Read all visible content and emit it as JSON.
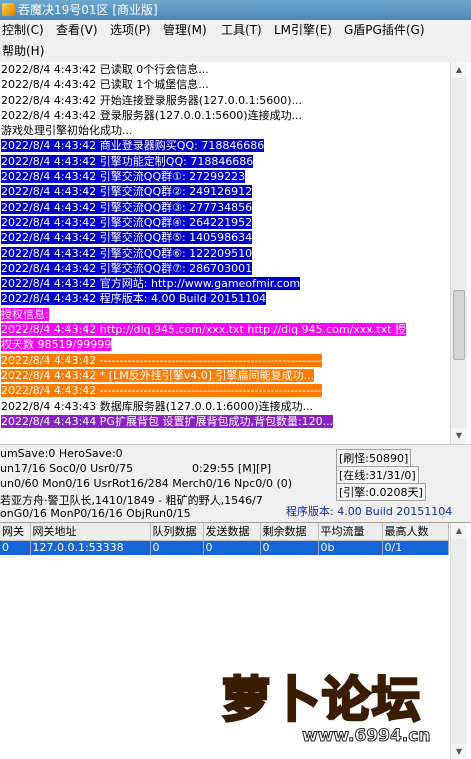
{
  "window": {
    "title": "吞魔决19号01区 [商业版]"
  },
  "menu": [
    "控制(C)",
    "查看(V)",
    "选项(P)",
    "管理(M)",
    "工具(T)",
    "LM引擎(E)",
    "G盾PG插件(G)",
    "帮助(H)"
  ],
  "log_lines": [
    {
      "text": "2022/8/4 4:43:42 已读取 0个行会信息...",
      "style": ""
    },
    {
      "text": "2022/8/4 4:43:42 已读取 1个城堡信息...",
      "style": ""
    },
    {
      "text": "2022/8/4 4:43:42 开始连接登录服务器(127.0.0.1:5600)...",
      "style": ""
    },
    {
      "text": "2022/8/4 4:43:42 登录服务器(127.0.0.1:5600)连接成功...",
      "style": ""
    },
    {
      "text": "游戏处理引擎初始化成功...",
      "style": ""
    },
    {
      "text": "2022/8/4 4:43:42 商业登录器购买QQ: 718846686",
      "style": "hl-blue"
    },
    {
      "text": "2022/8/4 4:43:42 引擎功能定制QQ: 718846686",
      "style": "hl-blue"
    },
    {
      "text": "2022/8/4 4:43:42 引擎交流QQ群①: 27299223",
      "style": "hl-blue"
    },
    {
      "text": "2022/8/4 4:43:42 引擎交流QQ群②: 249126912",
      "style": "hl-blue"
    },
    {
      "text": "2022/8/4 4:43:42 引擎交流QQ群③: 277734856",
      "style": "hl-blue"
    },
    {
      "text": "2022/8/4 4:43:42 引擎交流QQ群④: 264221952",
      "style": "hl-blue"
    },
    {
      "text": "2022/8/4 4:43:42 引擎交流QQ群⑤: 140598634",
      "style": "hl-blue"
    },
    {
      "text": "2022/8/4 4:43:42 引擎交流QQ群⑥: 122209510",
      "style": "hl-blue"
    },
    {
      "text": "2022/8/4 4:43:42 引擎交流QQ群⑦: 286703001",
      "style": "hl-blue"
    },
    {
      "text": "2022/8/4 4:43:42 官方网站: http://www.gameofmir.com",
      "style": "hl-blue"
    },
    {
      "text": "2022/8/4 4:43:42 程序版本: 4.00 Build 20151104",
      "style": "hl-blue"
    },
    {
      "text": "授权信息:",
      "style": "hl-pink"
    },
    {
      "text": "2022/8/4 4:43:42 http://dlq.945.com/xxx.txt http://dlq.945.com/xxx.txt 授",
      "style": "hl-pink"
    },
    {
      "text": "权天数 98519/99999",
      "style": "hl-pink"
    },
    {
      "text": "2022/8/4 4:43:42 --------------------------------------------------------",
      "style": "hl-orange"
    },
    {
      "text": "2022/8/4 4:43:42 * [LM反外挂引擎v4.0] 引擎扁间能复成功...",
      "style": "hl-orange"
    },
    {
      "text": "2022/8/4 4:43:42 --------------------------------------------------------",
      "style": "hl-orange"
    },
    {
      "text": "2022/8/4 4:43:43 数据库服务器(127.0.0.1:6000)连接成功...",
      "style": ""
    },
    {
      "text": "2022/8/4 4:43:44 PG扩展背包 设置扩展背包成功,背包数量:120...",
      "style": "hl-purple"
    }
  ],
  "status": {
    "line1": "umSave:0 HeroSave:0",
    "line2_left": "un17/16 Soc0/0 Usr0/75",
    "line2_mid": "0:29:55 [M][P]",
    "line3": "un0/60 Mon0/16 UsrRot16/284 Merch0/16 Npc0/0 (0)",
    "line4": "若亚方舟·警卫队长,1410/1849 - 粗矿的野人,1546/7",
    "line5": "onG0/16 MonP0/16/16 ObjRun0/15",
    "refresh": "[刷怪:50890]",
    "online": "[在线:31/31/0]",
    "engine": "[引擎:0.0208天]",
    "version": "程序版本: 4.00 Build 20151104"
  },
  "grid": {
    "columns": [
      "网关",
      "网关地址",
      "队列数据",
      "发送数据",
      "剩余数据",
      "平均流量",
      "最高人数"
    ],
    "rows": [
      [
        "0",
        "127.0.0.1:53338",
        "0",
        "0",
        "0",
        "0b",
        "0/1"
      ]
    ]
  },
  "watermark": {
    "text": "萝卜论坛",
    "url": "www.6994.cn"
  },
  "colors": {
    "title_bar": "#4c86b6",
    "highlight_blue": "#0000cc",
    "highlight_pink": "#ff00ff",
    "highlight_orange": "#ff7a00",
    "highlight_purple": "#8a22c8",
    "selected_row": "#1565d8"
  }
}
